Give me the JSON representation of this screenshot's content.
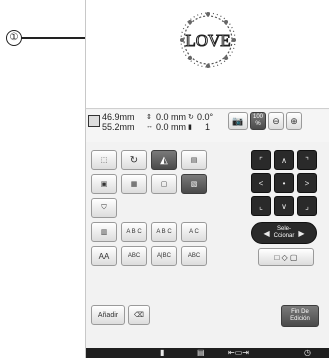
{
  "callout": {
    "number": "①"
  },
  "preview": {
    "embroidery_text": "LOVE"
  },
  "info": {
    "width_value": "46.9mm",
    "height_value": "55.2mm",
    "offset_v": "0.0 mm",
    "offset_h": "0.0 mm",
    "rotation": "0.0°",
    "color_count": "1",
    "zoom_value": "100",
    "zoom_unit": "%"
  },
  "buttons": {
    "abc_flat": "A B C",
    "abc_arc_up": "A B C",
    "abc_arc_down": "A B C",
    "abc_spacing": "A B C",
    "abc_wave": "A C",
    "aa_style": "AA",
    "abc_box1": "ABC",
    "abc_box2": "A|BC",
    "abc_box3": "ABC",
    "select_label_line1": "Sele-",
    "select_label_line2": "Ccionar",
    "add_label": "Añadir",
    "end_edit_line1": "Fin De",
    "end_edit_line2": "Edición"
  },
  "colors": {
    "accent_dark": "#4a4a4a",
    "bottom_bar": "#1f1f1f"
  }
}
